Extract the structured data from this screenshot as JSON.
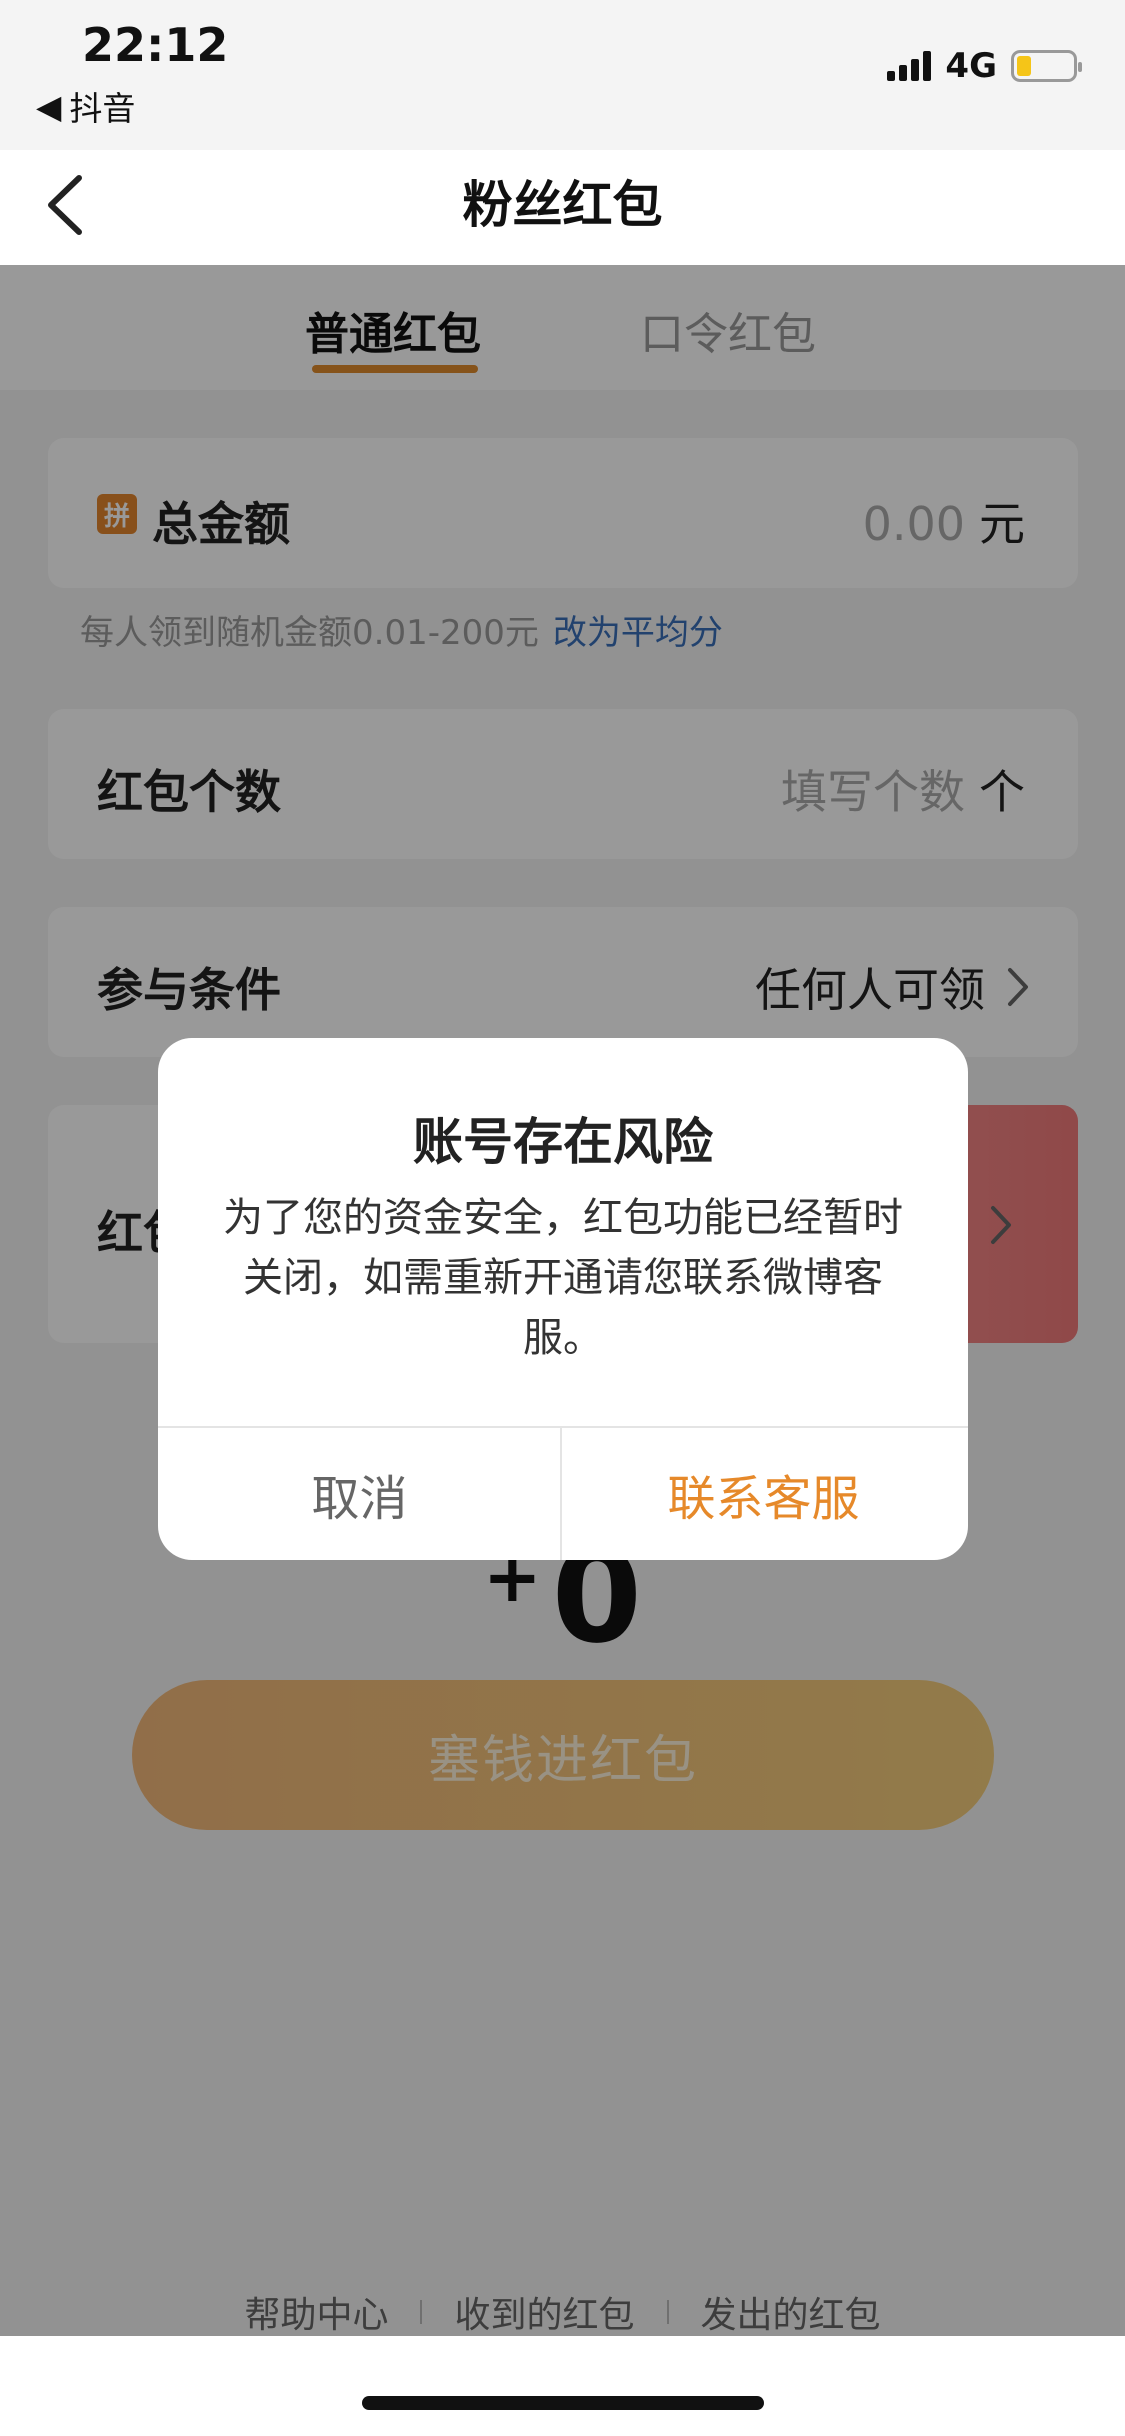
{
  "status_bar": {
    "time": "22:12",
    "back_app": "抖音",
    "network": "4G"
  },
  "nav": {
    "title": "粉丝红包"
  },
  "tabs": [
    {
      "label": "普通红包",
      "active": true
    },
    {
      "label": "口令红包",
      "active": false
    }
  ],
  "amount": {
    "badge": "拼",
    "label": "总金额",
    "value": "0.00",
    "unit": "元"
  },
  "hint": {
    "text": "每人领到随机金额0.01-200元",
    "link": "改为平均分"
  },
  "count": {
    "label": "红包个数",
    "placeholder": "填写个数",
    "unit": "个"
  },
  "condition": {
    "label": "参与条件",
    "value": "任何人可领"
  },
  "wish": {
    "label_partial": "红包"
  },
  "total": {
    "plus": "+",
    "value": "0"
  },
  "submit": {
    "label": "塞钱进红包"
  },
  "footer": {
    "links": [
      "帮助中心",
      "收到的红包",
      "发出的红包"
    ]
  },
  "dialog": {
    "title": "账号存在风险",
    "body": "为了您的资金安全，红包功能已经暂时关闭，如需重新开通请您联系微博客服。",
    "cancel": "取消",
    "confirm": "联系客服"
  },
  "colors": {
    "accent": "#e6892a",
    "link": "#3a6fb8",
    "overlay": "rgba(0,0,0,0.4)"
  }
}
